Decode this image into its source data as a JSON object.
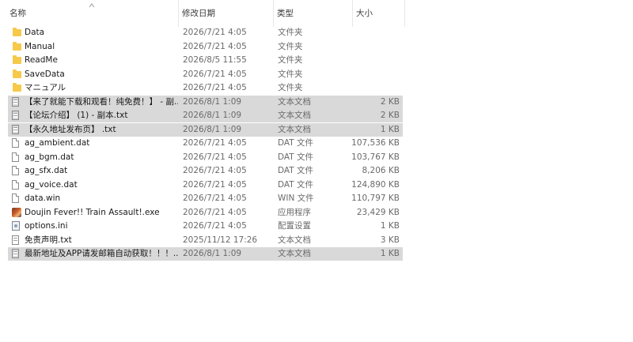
{
  "columns": {
    "name": "名称",
    "date": "修改日期",
    "type": "类型",
    "size": "大小"
  },
  "files": [
    {
      "name": "Data",
      "date": "2026/7/21 4:05",
      "type": "文件夹",
      "size": "",
      "icon": "folder-icon",
      "selected": false
    },
    {
      "name": "Manual",
      "date": "2026/7/21 4:05",
      "type": "文件夹",
      "size": "",
      "icon": "folder-icon",
      "selected": false
    },
    {
      "name": "ReadMe",
      "date": "2026/8/5 11:55",
      "type": "文件夹",
      "size": "",
      "icon": "folder-icon",
      "selected": false
    },
    {
      "name": "SaveData",
      "date": "2026/7/21 4:05",
      "type": "文件夹",
      "size": "",
      "icon": "folder-icon",
      "selected": false
    },
    {
      "name": "マニュアル",
      "date": "2026/7/21 4:05",
      "type": "文件夹",
      "size": "",
      "icon": "folder-icon",
      "selected": false
    },
    {
      "name": "【来了就能下载和观看！纯免费！】 - 副...",
      "date": "2026/8/1 1:09",
      "type": "文本文档",
      "size": "2 KB",
      "icon": "text-document-icon",
      "selected": true
    },
    {
      "name": "【论坛介绍】 (1) - 副本.txt",
      "date": "2026/8/1 1:09",
      "type": "文本文档",
      "size": "2 KB",
      "icon": "text-document-icon",
      "selected": true
    },
    {
      "name": "【永久地址发布页】 .txt",
      "date": "2026/8/1 1:09",
      "type": "文本文档",
      "size": "1 KB",
      "icon": "text-document-icon",
      "selected": true
    },
    {
      "name": "ag_ambient.dat",
      "date": "2026/7/21 4:05",
      "type": "DAT 文件",
      "size": "107,536 KB",
      "icon": "file-icon",
      "selected": false
    },
    {
      "name": "ag_bgm.dat",
      "date": "2026/7/21 4:05",
      "type": "DAT 文件",
      "size": "103,767 KB",
      "icon": "file-icon",
      "selected": false
    },
    {
      "name": "ag_sfx.dat",
      "date": "2026/7/21 4:05",
      "type": "DAT 文件",
      "size": "8,206 KB",
      "icon": "file-icon",
      "selected": false
    },
    {
      "name": "ag_voice.dat",
      "date": "2026/7/21 4:05",
      "type": "DAT 文件",
      "size": "124,890 KB",
      "icon": "file-icon",
      "selected": false
    },
    {
      "name": "data.win",
      "date": "2026/7/21 4:05",
      "type": "WIN 文件",
      "size": "110,797 KB",
      "icon": "file-icon",
      "selected": false
    },
    {
      "name": "Doujin Fever!! Train Assault!.exe",
      "date": "2026/7/21 4:05",
      "type": "应用程序",
      "size": "23,429 KB",
      "icon": "application-icon",
      "selected": false
    },
    {
      "name": "options.ini",
      "date": "2026/7/21 4:05",
      "type": "配置设置",
      "size": "1 KB",
      "icon": "config-file-icon",
      "selected": false
    },
    {
      "name": "免责声明.txt",
      "date": "2025/11/12 17:26",
      "type": "文本文档",
      "size": "3 KB",
      "icon": "text-document-icon",
      "selected": false
    },
    {
      "name": "最新地址及APP请发邮箱自动获取！！！...",
      "date": "2026/8/1 1:09",
      "type": "文本文档",
      "size": "1 KB",
      "icon": "text-document-icon",
      "selected": true
    }
  ]
}
